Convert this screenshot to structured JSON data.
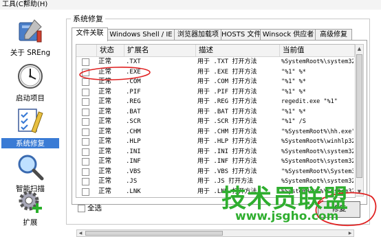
{
  "menu": [
    "工具(C)",
    "帮助(H)"
  ],
  "sidebar": {
    "items": [
      {
        "label": "关于 SREng",
        "icon": "tools-icon",
        "active": false
      },
      {
        "label": "启动项目",
        "icon": "clock-icon",
        "active": false
      },
      {
        "label": "系统修复",
        "icon": "repair-check-icon",
        "active": true
      },
      {
        "label": "智能扫描",
        "icon": "magnifier-icon",
        "active": false
      },
      {
        "label": "扩展",
        "icon": "gear-plus-icon",
        "active": false
      }
    ]
  },
  "group_title": "系统修复",
  "tabs": [
    "文件关联",
    "Windows Shell / IE",
    "浏览器加载项",
    "HOSTS 文件",
    "Winsock 供应者",
    "高级修复"
  ],
  "table": {
    "columns": [
      "状态",
      "扩展名",
      "描述",
      "当前值"
    ],
    "rows": [
      {
        "status": "正常",
        "ext": ".TXT",
        "desc": "用于 .TXT 打开方法",
        "value": "%SystemRoot%\\system32\\"
      },
      {
        "status": "正常",
        "ext": ".EXE",
        "desc": "用于 .EXE 打开方法",
        "value": "\"%1\" %*"
      },
      {
        "status": "正常",
        "ext": ".COM",
        "desc": "用于 .COM 打开方法",
        "value": "\"%1\" %*"
      },
      {
        "status": "正常",
        "ext": ".PIF",
        "desc": "用于 .PIF 打开方法",
        "value": "\"%1\" %*"
      },
      {
        "status": "正常",
        "ext": ".REG",
        "desc": "用于 .REG 打开方法",
        "value": "regedit.exe \"%1\""
      },
      {
        "status": "正常",
        "ext": ".BAT",
        "desc": "用于 .BAT 打开方法",
        "value": "\"%1\" %*"
      },
      {
        "status": "正常",
        "ext": ".SCR",
        "desc": "用于 .SCR 打开方法",
        "value": "\"%1\" /S"
      },
      {
        "status": "正常",
        "ext": ".CHM",
        "desc": "用于 .CHM 打开方法",
        "value": "\"%SystemRoot%\\hh.exe\""
      },
      {
        "status": "正常",
        "ext": ".HLP",
        "desc": "用于 .HLP 打开方法",
        "value": "%SystemRoot%\\winhlp32."
      },
      {
        "status": "正常",
        "ext": ".INI",
        "desc": "用于 .INI 打开方法",
        "value": "%SystemRoot%\\system32\\"
      },
      {
        "status": "正常",
        "ext": ".INF",
        "desc": "用于 .INF 打开方法",
        "value": "%SystemRoot%\\system32\\"
      },
      {
        "status": "正常",
        "ext": ".VBS",
        "desc": "用于 .VBS 打开方法",
        "value": "\"%SystemRoot%\\System32"
      },
      {
        "status": "正常",
        "ext": ".JS",
        "desc": "用于 .JS 打开方法",
        "value": "%SystemRoot%\\system32\\"
      },
      {
        "status": "正常",
        "ext": ".LNK",
        "desc": "用于 .LNK 打开方法",
        "value": "%SystemRoot%\\system32\\"
      }
    ]
  },
  "select_all_label": "全选",
  "repair_button_label": "修复",
  "watermark": {
    "title": "技术员联盟",
    "url": "www.jsgho.com"
  },
  "colors": {
    "accent": "#3a7bd5",
    "annotation": "#e02020",
    "watermark": "#2fae2f"
  }
}
